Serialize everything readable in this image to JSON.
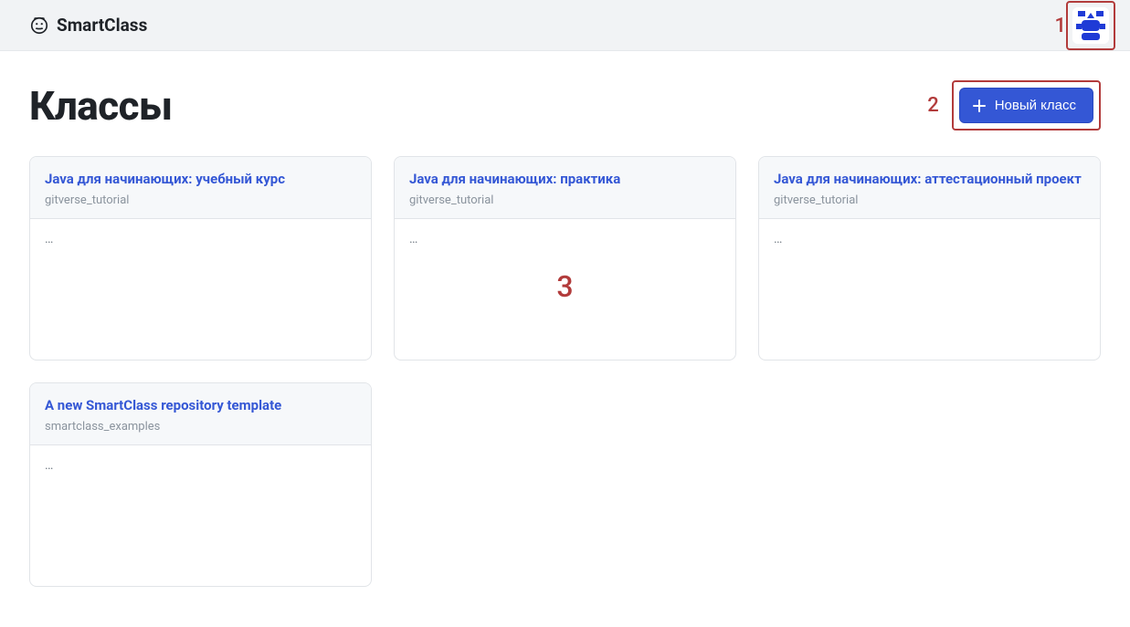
{
  "brand": {
    "name": "SmartClass"
  },
  "annotations": {
    "one": "1",
    "two": "2",
    "three": "3"
  },
  "page": {
    "title": "Классы"
  },
  "actions": {
    "new_class_label": "Новый класс"
  },
  "cards": [
    {
      "title": "Java для начинающих: учебный курс",
      "owner": "gitverse_tutorial",
      "desc": "…"
    },
    {
      "title": "Java для начинающих: практика",
      "owner": "gitverse_tutorial",
      "desc": "…"
    },
    {
      "title": "Java для начинающих: аттестационный проект",
      "owner": "gitverse_tutorial",
      "desc": "…"
    },
    {
      "title": "A new SmartClass repository template",
      "owner": "smartclass_examples",
      "desc": "…"
    }
  ]
}
